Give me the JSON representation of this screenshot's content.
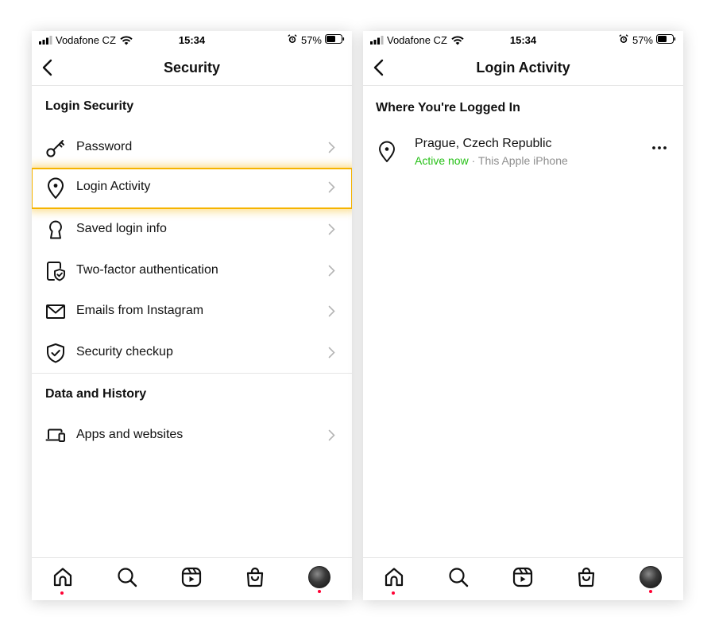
{
  "status": {
    "carrier": "Vodafone CZ",
    "time": "15:34",
    "battery": "57%"
  },
  "left": {
    "title": "Security",
    "section1": "Login Security",
    "items": [
      {
        "label": "Password",
        "icon": "key-icon"
      },
      {
        "label": "Login Activity",
        "icon": "location-pin-icon"
      },
      {
        "label": "Saved login info",
        "icon": "keyhole-icon"
      },
      {
        "label": "Two-factor authentication",
        "icon": "phone-shield-icon"
      },
      {
        "label": "Emails from Instagram",
        "icon": "envelope-icon"
      },
      {
        "label": "Security checkup",
        "icon": "shield-check-icon"
      }
    ],
    "section2": "Data and History",
    "items2": [
      {
        "label": "Apps and websites",
        "icon": "devices-icon"
      }
    ]
  },
  "right": {
    "title": "Login Activity",
    "heading": "Where You're Logged In",
    "session": {
      "location": "Prague, Czech Republic",
      "status": "Active now",
      "separator": " · ",
      "device": "This Apple iPhone"
    }
  },
  "tabs": [
    "home-icon",
    "search-icon",
    "reels-icon",
    "shop-icon",
    "profile-avatar"
  ],
  "colors": {
    "highlight": "#f6b400",
    "active": "#25c016",
    "notification_dot": "#ff0033"
  }
}
